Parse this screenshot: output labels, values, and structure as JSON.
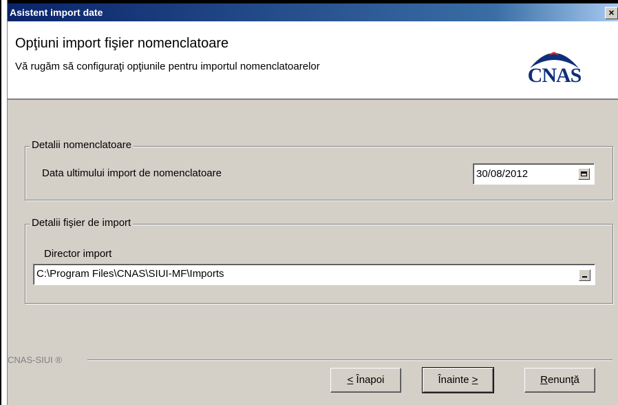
{
  "window": {
    "title": "Asistent import date",
    "close_label": "×"
  },
  "header": {
    "title": "Opţiuni import fişier nomenclatoare",
    "subtitle": "Vă rugăm să configuraţi opţiunile pentru importul nomenclatoarelor",
    "logo_text": "CNAS",
    "logo_colors": {
      "text": "#0f2f7a",
      "arc": "#0f2f7a",
      "accent": "#e22b2b"
    }
  },
  "group_nomenclatoare": {
    "legend": "Detalii nomenclatoare",
    "last_import_label": "Data ultimului import de nomenclatoare",
    "last_import_value": "30/08/2012",
    "calendar_icon": "calendar-icon"
  },
  "group_import_file": {
    "legend": "Detalii fişier de import",
    "directory_label": "Director import",
    "directory_value": "C:\\Program Files\\CNAS\\SIUI-MF\\Imports",
    "browse_icon": "ellipsis-icon"
  },
  "footer": {
    "brand": "CNAS-SIUI ®"
  },
  "buttons": {
    "back_mnemonic": "<",
    "back_rest": " Înapoi",
    "next_main": "Înainte ",
    "next_mnemonic": ">",
    "cancel_mnemonic": "R",
    "cancel_rest": "enunţă"
  }
}
